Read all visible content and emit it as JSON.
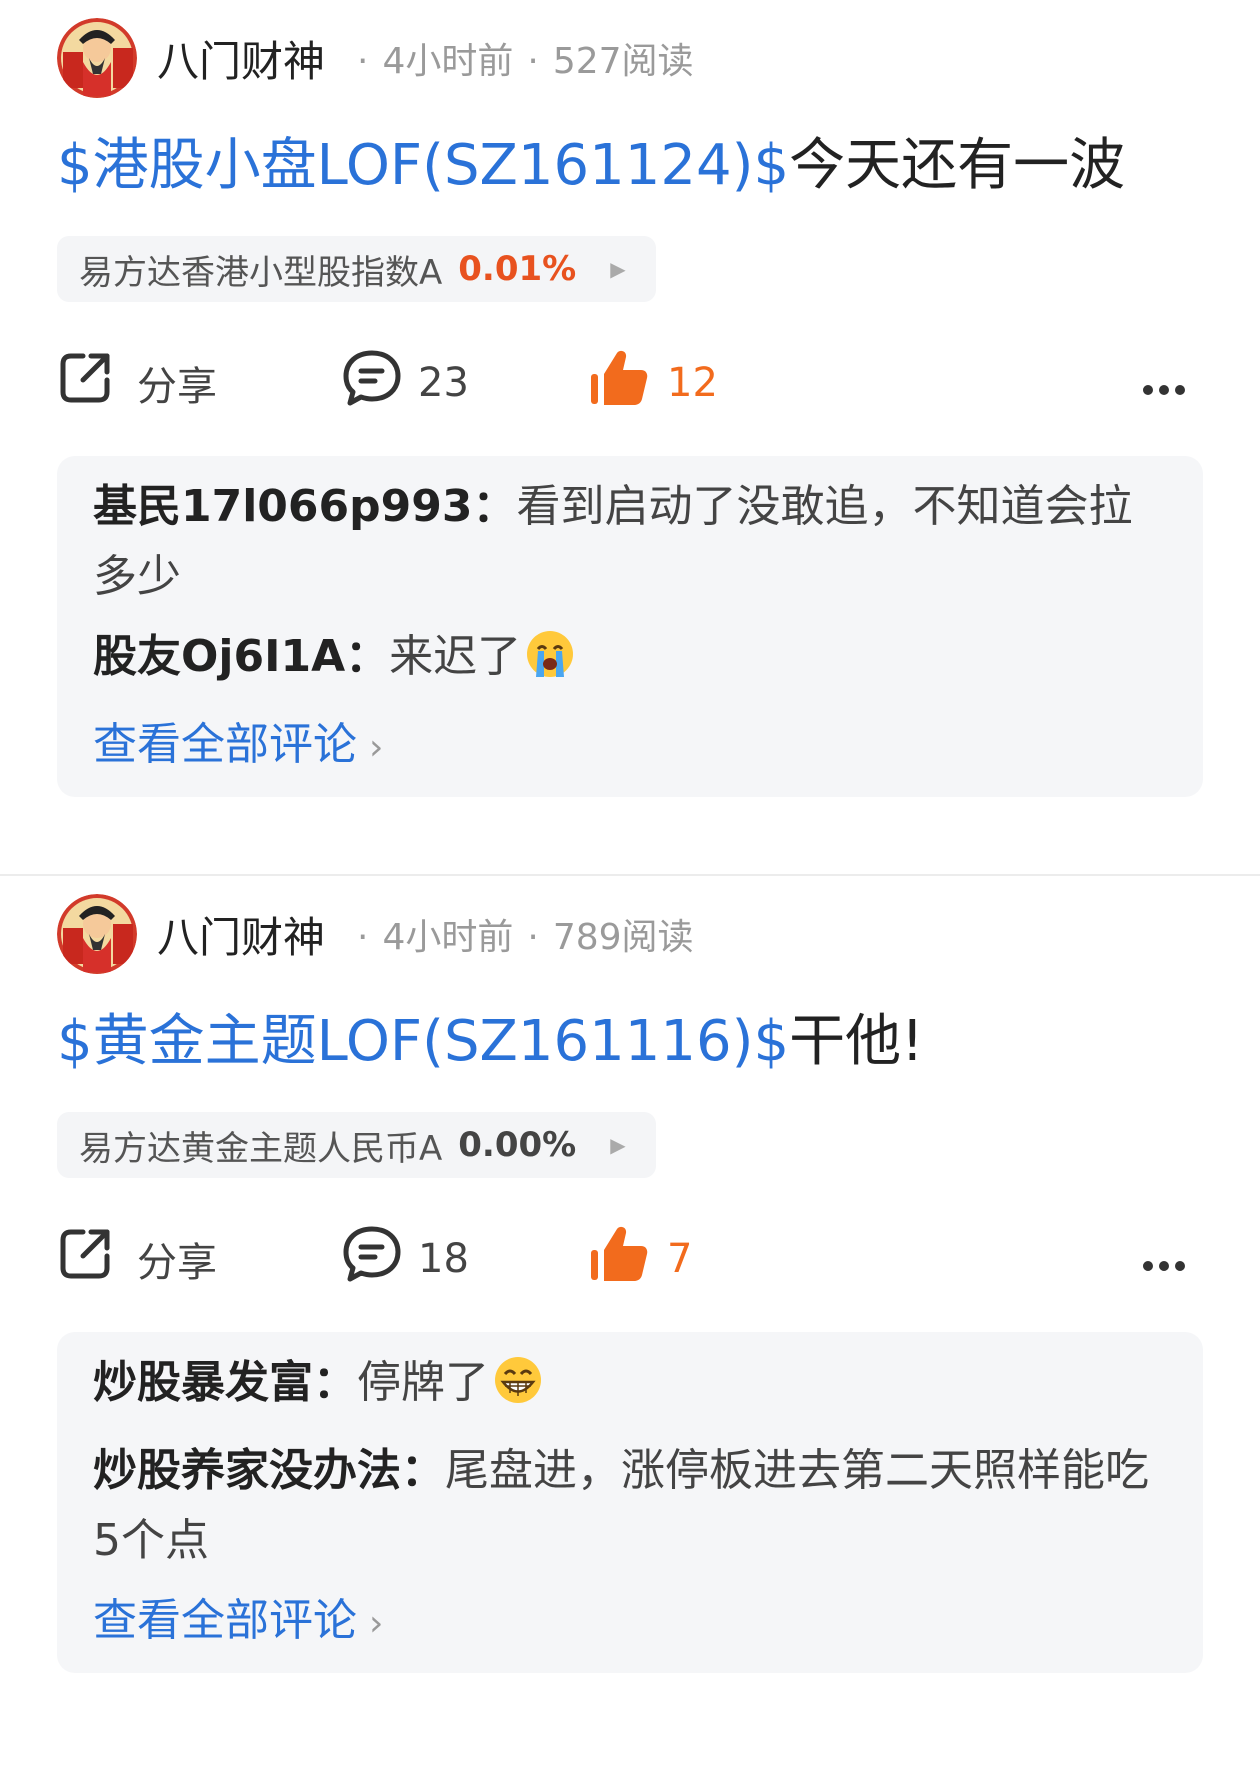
{
  "posts": [
    {
      "author": "八门财神",
      "time": "4小时前",
      "reads": "527阅读",
      "title_tag": "$港股小盘LOF(SZ161124)$",
      "title_text": "今天还有一波",
      "fund": {
        "name": "易方达香港小型股指数A",
        "change": "0.01%",
        "change_color": "#e8521f"
      },
      "share_label": "分享",
      "comment_count": "23",
      "like_count": "12",
      "comments": [
        {
          "user": "基民17l066p993",
          "sep": "：",
          "text": "看到启动了没敢追，不知道会拉多少",
          "emoji": ""
        },
        {
          "user": "股友Oj6I1A",
          "sep": "：",
          "text": "来迟了",
          "emoji": "crying-face"
        }
      ],
      "view_all": "查看全部评论"
    },
    {
      "author": "八门财神",
      "time": "4小时前",
      "reads": "789阅读",
      "title_tag": "$黄金主题LOF(SZ161116)$",
      "title_text": "干他!",
      "fund": {
        "name": "易方达黄金主题人民币A",
        "change": "0.00%",
        "change_color": "#444444"
      },
      "share_label": "分享",
      "comment_count": "18",
      "like_count": "7",
      "comments": [
        {
          "user": "炒股暴发富",
          "sep": "：",
          "text": "停牌了",
          "emoji": "grinning-face"
        },
        {
          "user": "炒股养家没办法",
          "sep": "：",
          "text": "尾盘进，涨停板进去第二天照样能吃5个点",
          "emoji": ""
        }
      ],
      "view_all": "查看全部评论"
    }
  ],
  "colors": {
    "link_blue": "#2a72d8",
    "like_orange": "#f26b1d"
  }
}
